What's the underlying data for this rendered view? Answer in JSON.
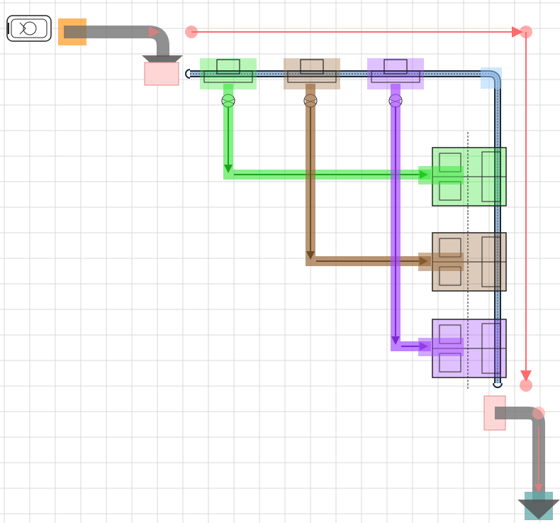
{
  "diagram": {
    "kind": "material-flow-layout",
    "grid": true,
    "background": "#ffffff",
    "colors": {
      "grid": "#d9d9d9",
      "conveyor": "#1c2a3a",
      "conveyor_fill": "#9fb8d6",
      "route_red": "#ff6b6b",
      "route_green": "#33e633",
      "route_brown": "#9a6a3a",
      "route_purple": "#a64dff",
      "supply_flow": "#6b6b6b",
      "source_pad": "#ff9f2e",
      "sink_pad": "#5fa8a8",
      "buffer": "#ffd6d6"
    },
    "icons": [
      "vehicle-icon",
      "arrow-down-icon",
      "conveyor-icon",
      "robot-cell-icon",
      "turntable-icon"
    ],
    "stations": [
      {
        "id": "pick-green",
        "color": "#33e633"
      },
      {
        "id": "pick-brown",
        "color": "#9a6a3a"
      },
      {
        "id": "pick-purple",
        "color": "#a64dff"
      }
    ],
    "work_cells": [
      {
        "id": "cell-1",
        "tint": "#33e633"
      },
      {
        "id": "cell-2",
        "tint": "#9a6a3a"
      },
      {
        "id": "cell-3",
        "tint": "#a64dff"
      }
    ]
  }
}
